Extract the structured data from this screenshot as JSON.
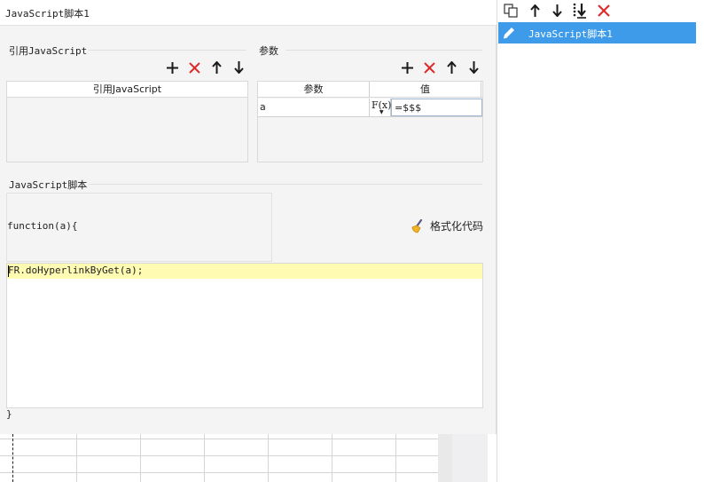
{
  "window": {
    "title": "JavaScript脚本1"
  },
  "references": {
    "section_label": "引用JavaScript",
    "column_header": "引用JavaScript",
    "toolbar": {
      "add_icon": "plus-icon",
      "remove_icon": "close-icon",
      "up_icon": "arrow-up-icon",
      "down_icon": "arrow-down-icon"
    }
  },
  "parameters": {
    "section_label": "参数",
    "columns": [
      "参数",
      "值"
    ],
    "rows": [
      {
        "name": "a",
        "formula_button": "F(x)",
        "value": "=$$$"
      }
    ]
  },
  "script": {
    "section_label": "JavaScript脚本",
    "function_signature": "function(a){",
    "format_button_label": "格式化代码",
    "format_icon": "broom-icon",
    "code": [
      "FR.doHyperlinkByGet",
      "(",
      "a",
      ")",
      ";"
    ],
    "closing": "}"
  },
  "sidebar": {
    "toolbar_icons": [
      "copy-icon",
      "arrow-up-icon",
      "arrow-down-icon",
      "move-bottom-icon",
      "close-icon"
    ],
    "items": [
      {
        "label": "JavaScript脚本1",
        "icon": "edit-pencil-icon",
        "selected": true
      }
    ]
  },
  "colors": {
    "selection": "#3d9be9",
    "delete": "#e02a2a",
    "line_highlight": "#fffbb3"
  }
}
